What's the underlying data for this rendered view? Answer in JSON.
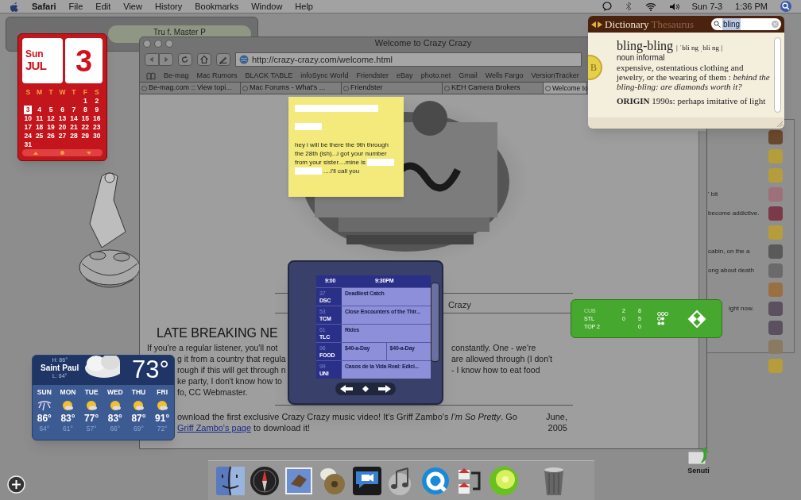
{
  "menu_bar": {
    "app": "Safari",
    "menus": [
      "File",
      "Edit",
      "View",
      "History",
      "Bookmarks",
      "Window",
      "Help"
    ],
    "day": "Sun 7-3",
    "time": "1:36 PM"
  },
  "itunes_widget": {
    "track": "Tru f. Master P"
  },
  "calendar_widget": {
    "weekday": "Sun",
    "month": "JUL",
    "day": "3",
    "weekdays": [
      "S",
      "M",
      "T",
      "W",
      "T",
      "F",
      "S"
    ],
    "weeks": [
      [
        {
          "label": "1",
          "selected": false
        },
        {
          "label": "2",
          "selected": false
        }
      ],
      [
        {
          "label": "3",
          "selected": true
        },
        {
          "label": "4",
          "selected": false
        },
        {
          "label": "5",
          "selected": false
        },
        {
          "label": "6",
          "selected": false
        },
        {
          "label": "7",
          "selected": false
        },
        {
          "label": "8",
          "selected": false
        },
        {
          "label": "9",
          "selected": false
        }
      ],
      [
        {
          "label": "10",
          "selected": false
        },
        {
          "label": "11",
          "selected": false
        },
        {
          "label": "12",
          "selected": false
        },
        {
          "label": "13",
          "selected": false
        },
        {
          "label": "14",
          "selected": false
        },
        {
          "label": "15",
          "selected": false
        },
        {
          "label": "16",
          "selected": false
        }
      ],
      [
        {
          "label": "17",
          "selected": false
        },
        {
          "label": "18",
          "selected": false
        },
        {
          "label": "19",
          "selected": false
        },
        {
          "label": "20",
          "selected": false
        },
        {
          "label": "21",
          "selected": false
        },
        {
          "label": "22",
          "selected": false
        },
        {
          "label": "23",
          "selected": false
        }
      ],
      [
        {
          "label": "24",
          "selected": false
        },
        {
          "label": "25",
          "selected": false
        },
        {
          "label": "26",
          "selected": false
        },
        {
          "label": "27",
          "selected": false
        },
        {
          "label": "28",
          "selected": false
        },
        {
          "label": "29",
          "selected": false
        },
        {
          "label": "30",
          "selected": false
        }
      ],
      [
        {
          "label": "31",
          "selected": false
        }
      ]
    ]
  },
  "browser": {
    "title": "Welcome to Crazy Crazy",
    "url": "http://crazy-crazy.com/welcome.html",
    "bookmarks": [
      "Be-mag",
      "Mac Rumors",
      "BLACK TABLE",
      "infoSync World",
      "Friendster",
      "eBay",
      "photo.net",
      "Gmail",
      "Wells Fargo",
      "VersionTracker"
    ],
    "tabs": [
      {
        "label": "Be-mag.com :: View topi...",
        "selected": false
      },
      {
        "label": "Mac Forums - What's ...",
        "selected": false
      },
      {
        "label": "Friendster",
        "selected": false
      },
      {
        "label": "KEH Camera Brokers",
        "selected": false
      },
      {
        "label": "Welcome to",
        "selected": true
      }
    ],
    "page": {
      "caption": "Crazy",
      "heading": "LATE BREAKING NE",
      "lines": [
        {
          "left": "If you're a regular listener, you'll not",
          "right": "constantly. One - we're"
        },
        {
          "left": "g it from a country that regula",
          "right": "are allowed through (I don't"
        },
        {
          "left": "rough if this will get through n",
          "right": "- I know how to eat food"
        },
        {
          "left": "ke party, I don't know how to"
        },
        {
          "left": "fo, CC Webmaster."
        }
      ],
      "news": {
        "text_before": "ownload the first exclusive Crazy Crazy music video! It's Griff Zambo's *I'm So Pretty*. Go",
        "link": "Griff Zambo's page",
        "text_after": " to download it!"
      },
      "date": "June, 2005"
    }
  },
  "chat_window": {
    "snippets": [
      "' bit",
      "become addictive.",
      "cabin, on the a",
      "ong about death",
      "ight now."
    ]
  },
  "sticky_note": {
    "segments": [
      {
        "kind": "redacted"
      },
      {
        "kind": "break"
      },
      {
        "kind": "redacted"
      },
      {
        "kind": "break"
      },
      {
        "kind": "text",
        "text": "hey i will be there the 9th through the 28th (ish)...i got your number from your sister....mine is "
      },
      {
        "kind": "redacted"
      },
      {
        "kind": "redacted"
      },
      {
        "kind": "text",
        "text": "....i'll call you"
      }
    ]
  },
  "dictionary": {
    "tabs": [
      {
        "label": "Dictionary",
        "selected": true
      },
      {
        "label": "Thesaurus",
        "selected": false
      }
    ],
    "query": "bling",
    "headword": "bling-bling",
    "pronunciation": "| ˈbli ng ˌbli ng |",
    "part_of_speech": "noun informal",
    "definition": "expensive, ostentatious clothing and jewelry, or the wearing of them : *behind the bling-bling: are diamonds worth it?*",
    "origin_label": "ORIGIN",
    "origin": "1990s: perhaps imitative of light",
    "letter": "B"
  },
  "tv_guide": {
    "times": [
      "9:00",
      "9:30PM"
    ],
    "channels": [
      {
        "number": "37",
        "network": "DSC",
        "shows": [
          "Deadliest Catch"
        ]
      },
      {
        "number": "53",
        "network": "TCM",
        "shows": [
          "Close Encounters of the Thir..."
        ]
      },
      {
        "number": "61",
        "network": "TLC",
        "shows": [
          "Rides"
        ]
      },
      {
        "number": "96",
        "network": "FOOD",
        "shows": [
          "$40-a-Day",
          "$40-a-Day"
        ]
      },
      {
        "number": "99",
        "network": "UNI",
        "shows": [
          "Casos de la Vida Real: Edici..."
        ]
      }
    ]
  },
  "sports_widget": {
    "rows": [
      {
        "team": "CUB",
        "runs": "2",
        "hits": "8"
      },
      {
        "team": "STL",
        "runs": "0",
        "hits": "5"
      },
      {
        "team": "TOP 2",
        "runs": "",
        "hits": "0"
      }
    ]
  },
  "weather_widget": {
    "high": "H: 86°",
    "city": "Saint Paul",
    "low": "L: 64°",
    "temperature": "73°",
    "days": [
      {
        "day": "SUN",
        "high": "86°",
        "low": "64°",
        "kind": "storm"
      },
      {
        "day": "MON",
        "high": "83°",
        "low": "61°",
        "kind": "sun"
      },
      {
        "day": "TUE",
        "high": "77°",
        "low": "57°",
        "kind": "sun"
      },
      {
        "day": "WED",
        "high": "83°",
        "low": "66°",
        "kind": "sun"
      },
      {
        "day": "THU",
        "high": "87°",
        "low": "69°",
        "kind": "sun"
      },
      {
        "day": "FRI",
        "high": "91°",
        "low": "72°",
        "kind": "sun"
      }
    ]
  },
  "dock": {
    "items": [
      {
        "kind": "finder"
      },
      {
        "kind": "compass"
      },
      {
        "kind": "mail"
      },
      {
        "kind": "disc"
      },
      {
        "kind": "video"
      },
      {
        "kind": "music"
      },
      {
        "kind": "q"
      },
      {
        "kind": "houses"
      },
      {
        "kind": "lime"
      },
      {
        "kind": "trash"
      }
    ],
    "desktop_item": "Senuti"
  }
}
